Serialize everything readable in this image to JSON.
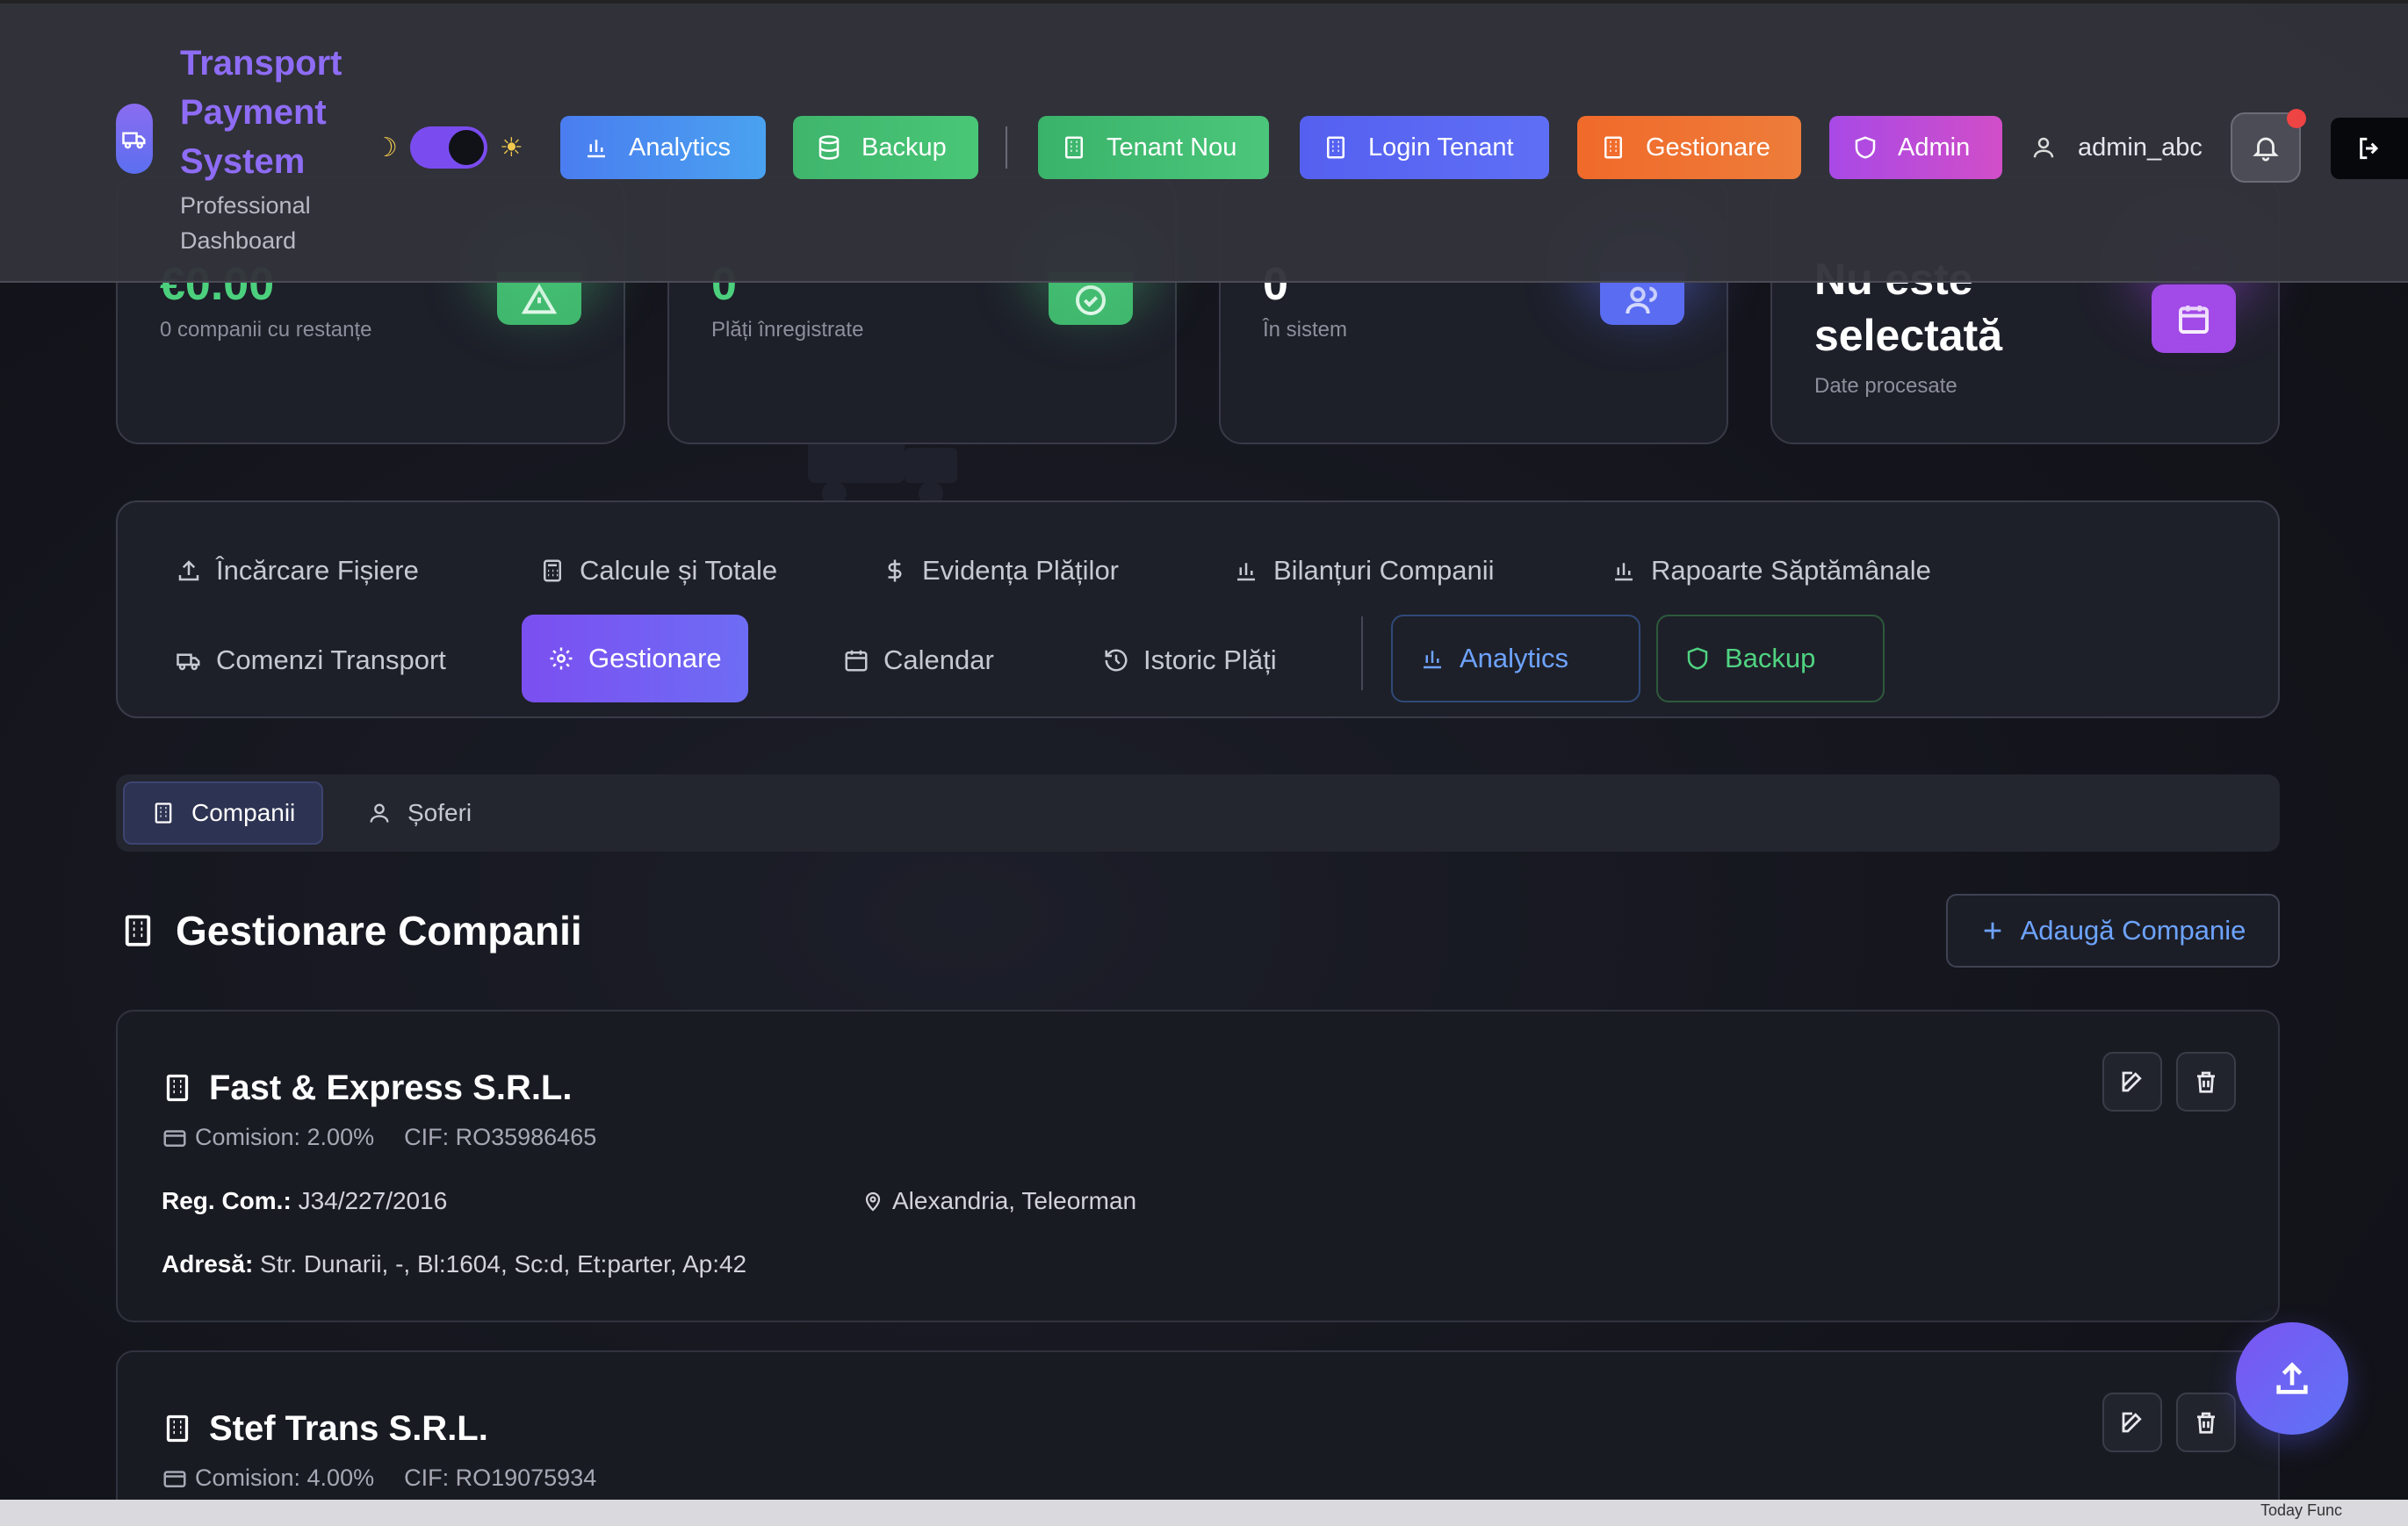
{
  "header": {
    "brand_title": "Transport Payment System",
    "brand_subtitle": "Professional Dashboard",
    "theme_moon": "☽",
    "theme_sun": "☀",
    "buttons": {
      "analytics": "Analytics",
      "backup": "Backup",
      "tenant_new": "Tenant Nou",
      "login_tenant": "Login Tenant",
      "gestionare": "Gestionare",
      "admin": "Admin"
    },
    "username": "admin_abc"
  },
  "stats": [
    {
      "value": "€0.00",
      "label": "0 companii cu restanțe"
    },
    {
      "value": "0",
      "label": "Plăți înregistrate"
    },
    {
      "value": "0",
      "label": "În sistem"
    },
    {
      "value": "Nu este selectată",
      "label": "Date procesate"
    }
  ],
  "nav": {
    "row1": [
      "Încărcare Fișiere",
      "Calcule și Totale",
      "Evidența Plăților",
      "Bilanțuri Companii",
      "Rapoarte Săptămânale"
    ],
    "row2": [
      "Comenzi Transport",
      "Gestionare",
      "Calendar",
      "Istoric Plăți"
    ],
    "analytics": "Analytics",
    "backup": "Backup",
    "active": "Gestionare"
  },
  "subtabs": {
    "companies": "Companii",
    "drivers": "Șoferi"
  },
  "section": {
    "title": "Gestionare Companii",
    "add_button": "Adaugă Companie"
  },
  "companies": [
    {
      "name": "Fast & Express S.R.L.",
      "commission": "Comision: 2.00%",
      "cif": "CIF: RO35986465",
      "reg_label": "Reg. Com.:",
      "reg": "J34/227/2016",
      "location": "Alexandria, Teleorman",
      "address_label": "Adresă:",
      "address": "Str. Dunarii, -, Bl:1604, Sc:d, Et:parter, Ap:42"
    },
    {
      "name": "Stef Trans S.R.L.",
      "commission": "Comision: 4.00%",
      "cif": "CIF: RO19075934"
    }
  ],
  "bottom_text": "Today Func",
  "colors": {
    "accent": "#7b4ff0",
    "success": "#4cd07d",
    "link": "#6da3ff",
    "danger": "#ef4444"
  }
}
